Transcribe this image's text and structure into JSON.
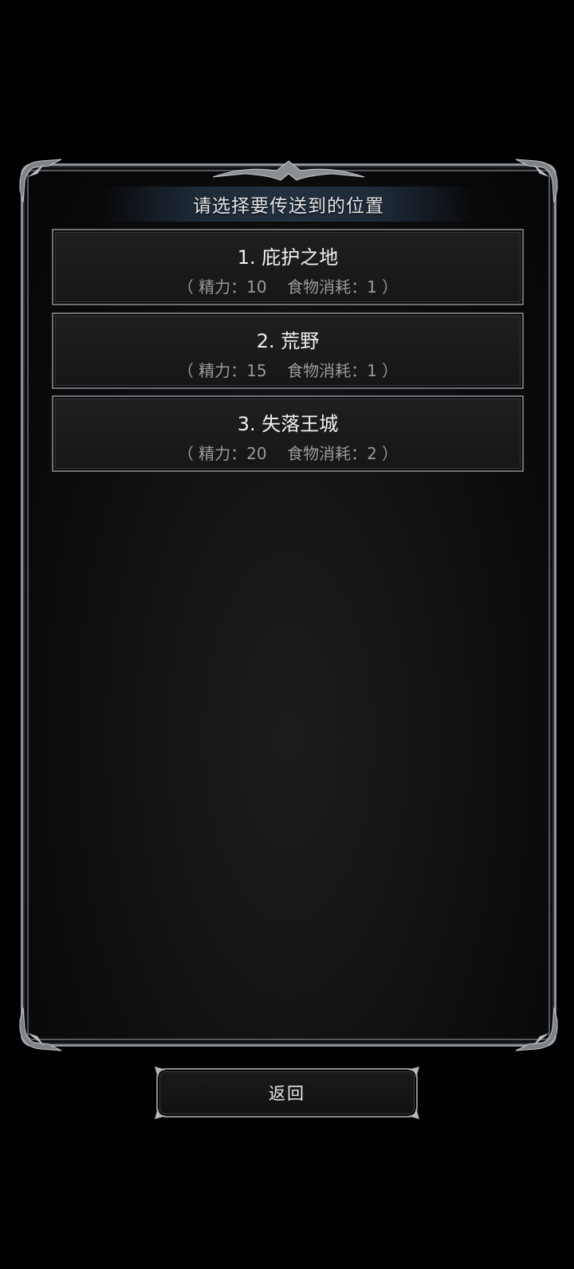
{
  "dialog": {
    "title": "请选择要传送到的位置",
    "options": [
      {
        "name": "1. 庇护之地",
        "cost": "（ 精力：10    食物消耗：1 ）"
      },
      {
        "name": "2. 荒野",
        "cost": "（ 精力：15    食物消耗：1 ）"
      },
      {
        "name": "3. 失落王城",
        "cost": "（ 精力：20    食物消耗：2 ）"
      }
    ]
  },
  "footer": {
    "back_label": "返回"
  },
  "colors": {
    "background": "#000000",
    "frame": "#8e9398",
    "title_bar": "#22303f",
    "option_fill": "#1b1b1b",
    "text_primary": "#f0f0f0",
    "text_secondary": "#9a9a9a"
  }
}
